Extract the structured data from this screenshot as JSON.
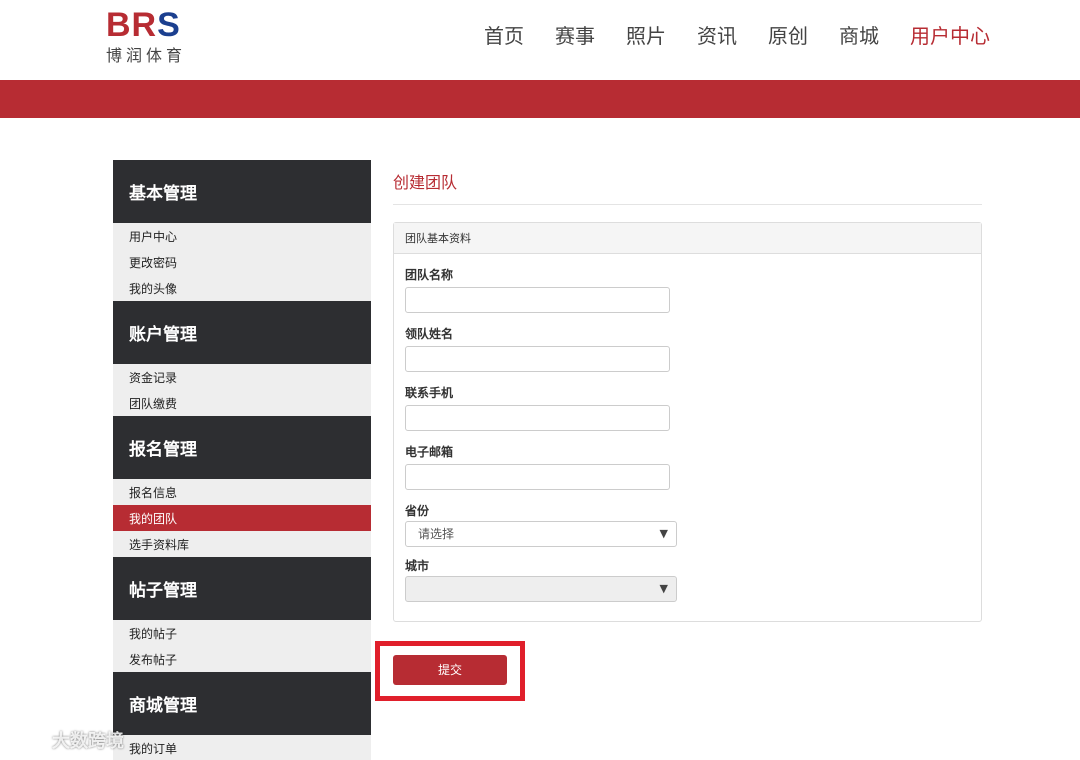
{
  "header": {
    "logo_mark_red": "BR",
    "logo_mark_blue": "S",
    "logo_sub": "博润体育",
    "nav": [
      "首页",
      "赛事",
      "照片",
      "资讯",
      "原创",
      "商城",
      "用户中心"
    ],
    "nav_active_index": 6
  },
  "colors": {
    "brand_red": "#b72c33",
    "sidebar_dark": "#2d2e31",
    "highlight_frame": "#e01f2b"
  },
  "sidebar": {
    "groups": [
      {
        "title": "基本管理",
        "items": [
          "用户中心",
          "更改密码",
          "我的头像"
        ]
      },
      {
        "title": "账户管理",
        "items": [
          "资金记录",
          "团队缴费"
        ]
      },
      {
        "title": "报名管理",
        "items": [
          "报名信息",
          "我的团队",
          "选手资料库"
        ]
      },
      {
        "title": "帖子管理",
        "items": [
          "我的帖子",
          "发布帖子"
        ]
      },
      {
        "title": "商城管理",
        "items": [
          "我的订单"
        ]
      }
    ],
    "active_item": "我的团队"
  },
  "main": {
    "title": "创建团队",
    "panel_title": "团队基本资料",
    "fields": {
      "team_name": {
        "label": "团队名称",
        "value": ""
      },
      "leader_name": {
        "label": "领队姓名",
        "value": ""
      },
      "phone": {
        "label": "联系手机",
        "value": ""
      },
      "email": {
        "label": "电子邮箱",
        "value": ""
      },
      "province": {
        "label": "省份",
        "selected": "请选择"
      },
      "city": {
        "label": "城市",
        "selected": ""
      }
    },
    "submit_label": "提交"
  },
  "watermark": {
    "text": "大数跨境",
    "icon": "watermark-logo-icon"
  }
}
